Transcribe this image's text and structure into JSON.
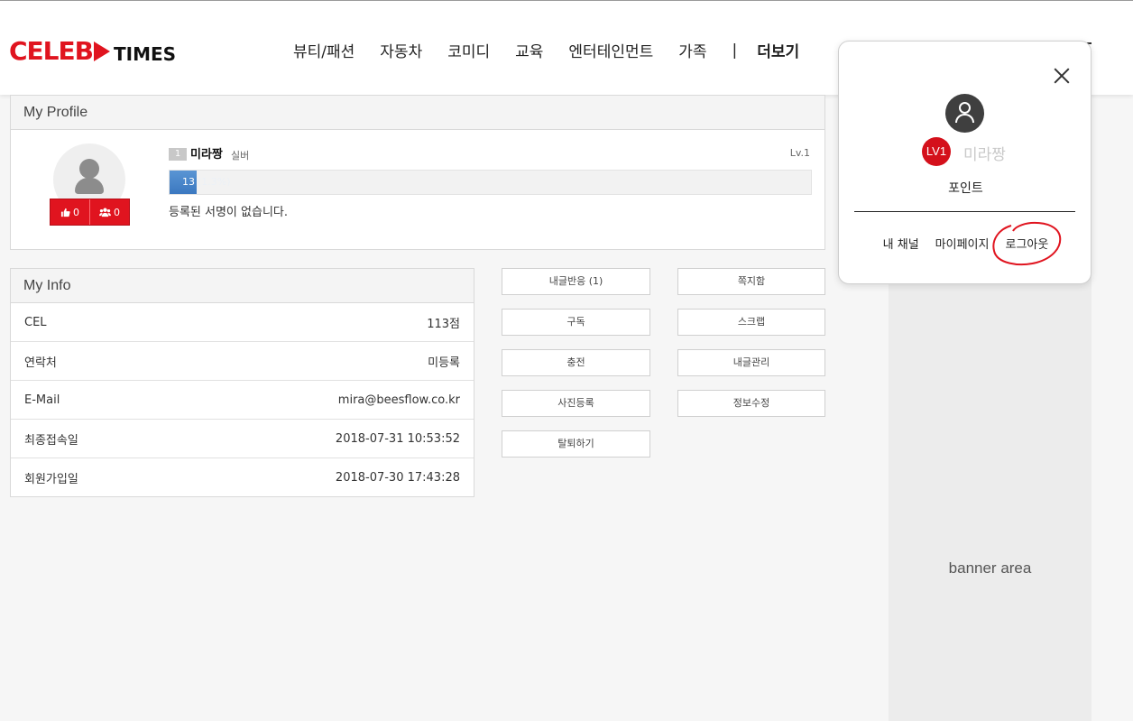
{
  "header": {
    "logo_main": "CELEB",
    "logo_sub": "TIMES",
    "nav": [
      "뷰티/패션",
      "자동차",
      "코미디",
      "교육",
      "엔터테인먼트",
      "가족"
    ],
    "nav_separator": "|",
    "more": "더보기"
  },
  "profile": {
    "title": "My Profile",
    "level_badge": "1",
    "nickname": "미라짱",
    "grade": "실버",
    "level_label": "Lv.1",
    "likes": "0",
    "friends": "0",
    "progress_value": "13",
    "progress_percent": "(1.3%)",
    "progress_fraction": 0.013,
    "signature": "등록된 서명이 없습니다."
  },
  "info": {
    "title": "My Info",
    "rows": [
      {
        "label": "CEL",
        "value": "113점"
      },
      {
        "label": "연락처",
        "value": "미등록"
      },
      {
        "label": "E-Mail",
        "value": "mira@beesflow.co.kr"
      },
      {
        "label": "최종접속일",
        "value": "2018-07-31 10:53:52"
      },
      {
        "label": "회원가입일",
        "value": "2018-07-30 17:43:28"
      }
    ]
  },
  "buttons": {
    "comment_reaction": "내글반응 (1)",
    "message_box": "쪽지함",
    "subscribe": "구독",
    "scrap": "스크랩",
    "charge": "충전",
    "post_manage": "내글관리",
    "photo_register": "사진등록",
    "edit_info": "정보수정",
    "withdraw": "탈퇴하기"
  },
  "banner": {
    "text": "banner area"
  },
  "popup": {
    "level": "LV1",
    "nickname": "미라짱",
    "point": "포인트",
    "links": [
      "내 채널",
      "마이페이지",
      "로그아웃"
    ]
  },
  "colors": {
    "accent": "#e0141f",
    "progress": "#3b78c0",
    "annotation": "#e0141f"
  }
}
